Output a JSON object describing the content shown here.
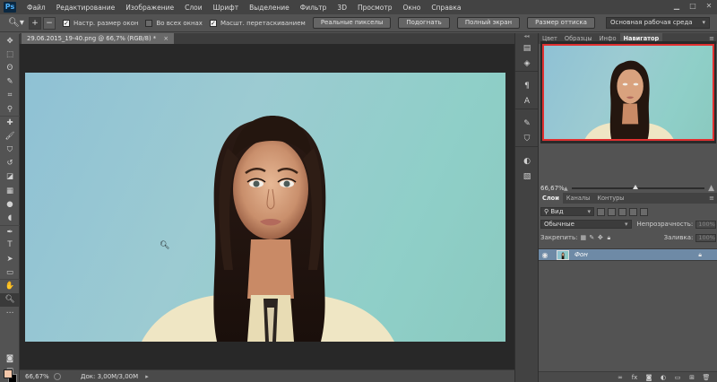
{
  "menubar": {
    "logo": "Ps",
    "items": [
      "Файл",
      "Редактирование",
      "Изображение",
      "Слои",
      "Шрифт",
      "Выделение",
      "Фильтр",
      "3D",
      "Просмотр",
      "Окно",
      "Справка"
    ]
  },
  "optionsbar": {
    "tool_icon": "zoom-icon",
    "zoom_in": "+",
    "zoom_out": "−",
    "checkboxes": [
      {
        "label": "Настр. размер окон",
        "checked": true
      },
      {
        "label": "Во всех окнах",
        "checked": false
      },
      {
        "label": "Масшт. перетаскиванием",
        "checked": true
      }
    ],
    "buttons": [
      "Реальные пикселы",
      "Подогнать",
      "Полный экран",
      "Размер оттиска"
    ],
    "workspace": "Основная рабочая среда"
  },
  "document": {
    "tab_title": "29.06.2015_19-40.png @ 66,7% (RGB/8) *",
    "close": "×"
  },
  "statusbar": {
    "zoom": "66,67%",
    "doc_info": "Док: 3,00M/3,00M"
  },
  "navigator": {
    "tabs": [
      "Цвет",
      "Образцы",
      "Инфо",
      "Навигатор"
    ],
    "active_tab": "Навигатор",
    "zoom": "66,67%",
    "zoom_level": 0.46
  },
  "layers": {
    "tabs": [
      "Слои",
      "Каналы",
      "Контуры"
    ],
    "active_tab": "Слои",
    "filter_kind": "Вид",
    "blend_mode": "Обычные",
    "opacity_label": "Непрозрачность:",
    "opacity_value": "100%",
    "lock_label": "Закрепить:",
    "fill_label": "Заливка:",
    "fill_value": "100%",
    "layer_name": "Фон"
  },
  "colors": {
    "foreground": "#f4c7a9",
    "background": "#000000",
    "navigator_frame": "#e03030",
    "selected_layer": "#6e8aa6"
  }
}
